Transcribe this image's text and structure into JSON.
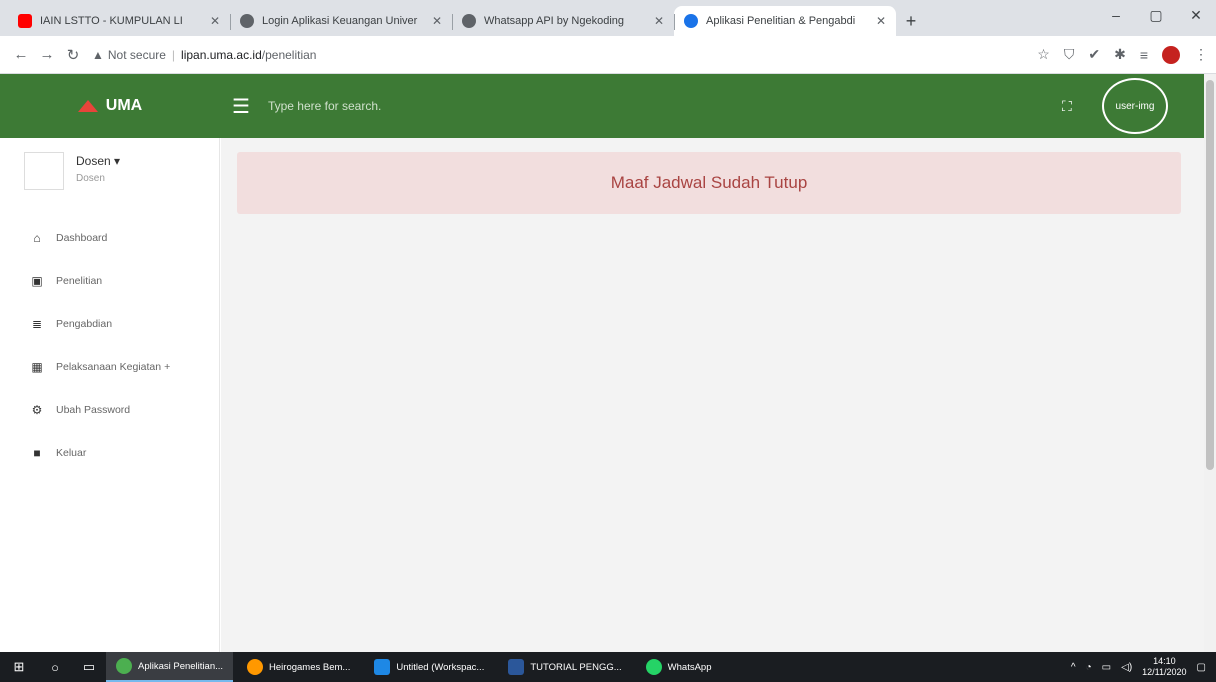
{
  "browser": {
    "tabs": [
      {
        "label": "IAIN LSTTO - KUMPULAN LI",
        "icon": "youtube-icon",
        "color": "#ff0000",
        "active": false
      },
      {
        "label": "Login Aplikasi Keuangan Univer",
        "icon": "globe-icon",
        "color": "#5f6368",
        "active": false
      },
      {
        "label": "Whatsapp API by Ngekoding",
        "icon": "globe-icon",
        "color": "#5f6368",
        "active": false
      },
      {
        "label": "Aplikasi Penelitian & Pengabdi",
        "icon": "info-icon",
        "color": "#1a73e8",
        "active": true
      }
    ],
    "new_tab": "+",
    "window_controls": {
      "minimize": "–",
      "maximize": "▢",
      "close": "✕"
    },
    "security": "Not secure",
    "url_host": "lipan.uma.ac.id",
    "url_path": "/penelitian"
  },
  "header": {
    "brand": "UMA",
    "search_placeholder": "Type here for search.",
    "avatar_alt": "user-img"
  },
  "sidebar": {
    "user_name": "Dosen",
    "user_role": "Dosen",
    "items": [
      {
        "label": "Dashboard",
        "icon": "home-icon",
        "glyph": "⌂"
      },
      {
        "label": "Penelitian",
        "icon": "clipboard-icon",
        "glyph": "▣"
      },
      {
        "label": "Pengabdian",
        "icon": "list-icon",
        "glyph": "≣"
      },
      {
        "label": "Pelaksanaan Kegiatan",
        "icon": "grid-icon",
        "glyph": "▦"
      },
      {
        "label": "Ubah Password",
        "icon": "user-key-icon",
        "glyph": "⚙"
      },
      {
        "label": "Keluar",
        "icon": "lock-icon",
        "glyph": "🔒"
      }
    ]
  },
  "main": {
    "alert": "Maaf Jadwal Sudah Tutup"
  },
  "taskbar": {
    "apps": [
      {
        "label": "Aplikasi Penelitian...",
        "color": "#4caf50",
        "active": true
      },
      {
        "label": "Heirogames Bem...",
        "color": "#ff9800",
        "active": false
      },
      {
        "label": "Untitled (Workspac...",
        "color": "#1e88e5",
        "active": false
      },
      {
        "label": "TUTORIAL PENGG...",
        "color": "#2b579a",
        "active": false
      },
      {
        "label": "WhatsApp",
        "color": "#25d366",
        "active": false
      }
    ],
    "time": "14:10",
    "date": "12/11/2020"
  },
  "colors": {
    "header": "#3d7a35",
    "alert_bg": "#f2dede",
    "alert_text": "#a94442"
  }
}
